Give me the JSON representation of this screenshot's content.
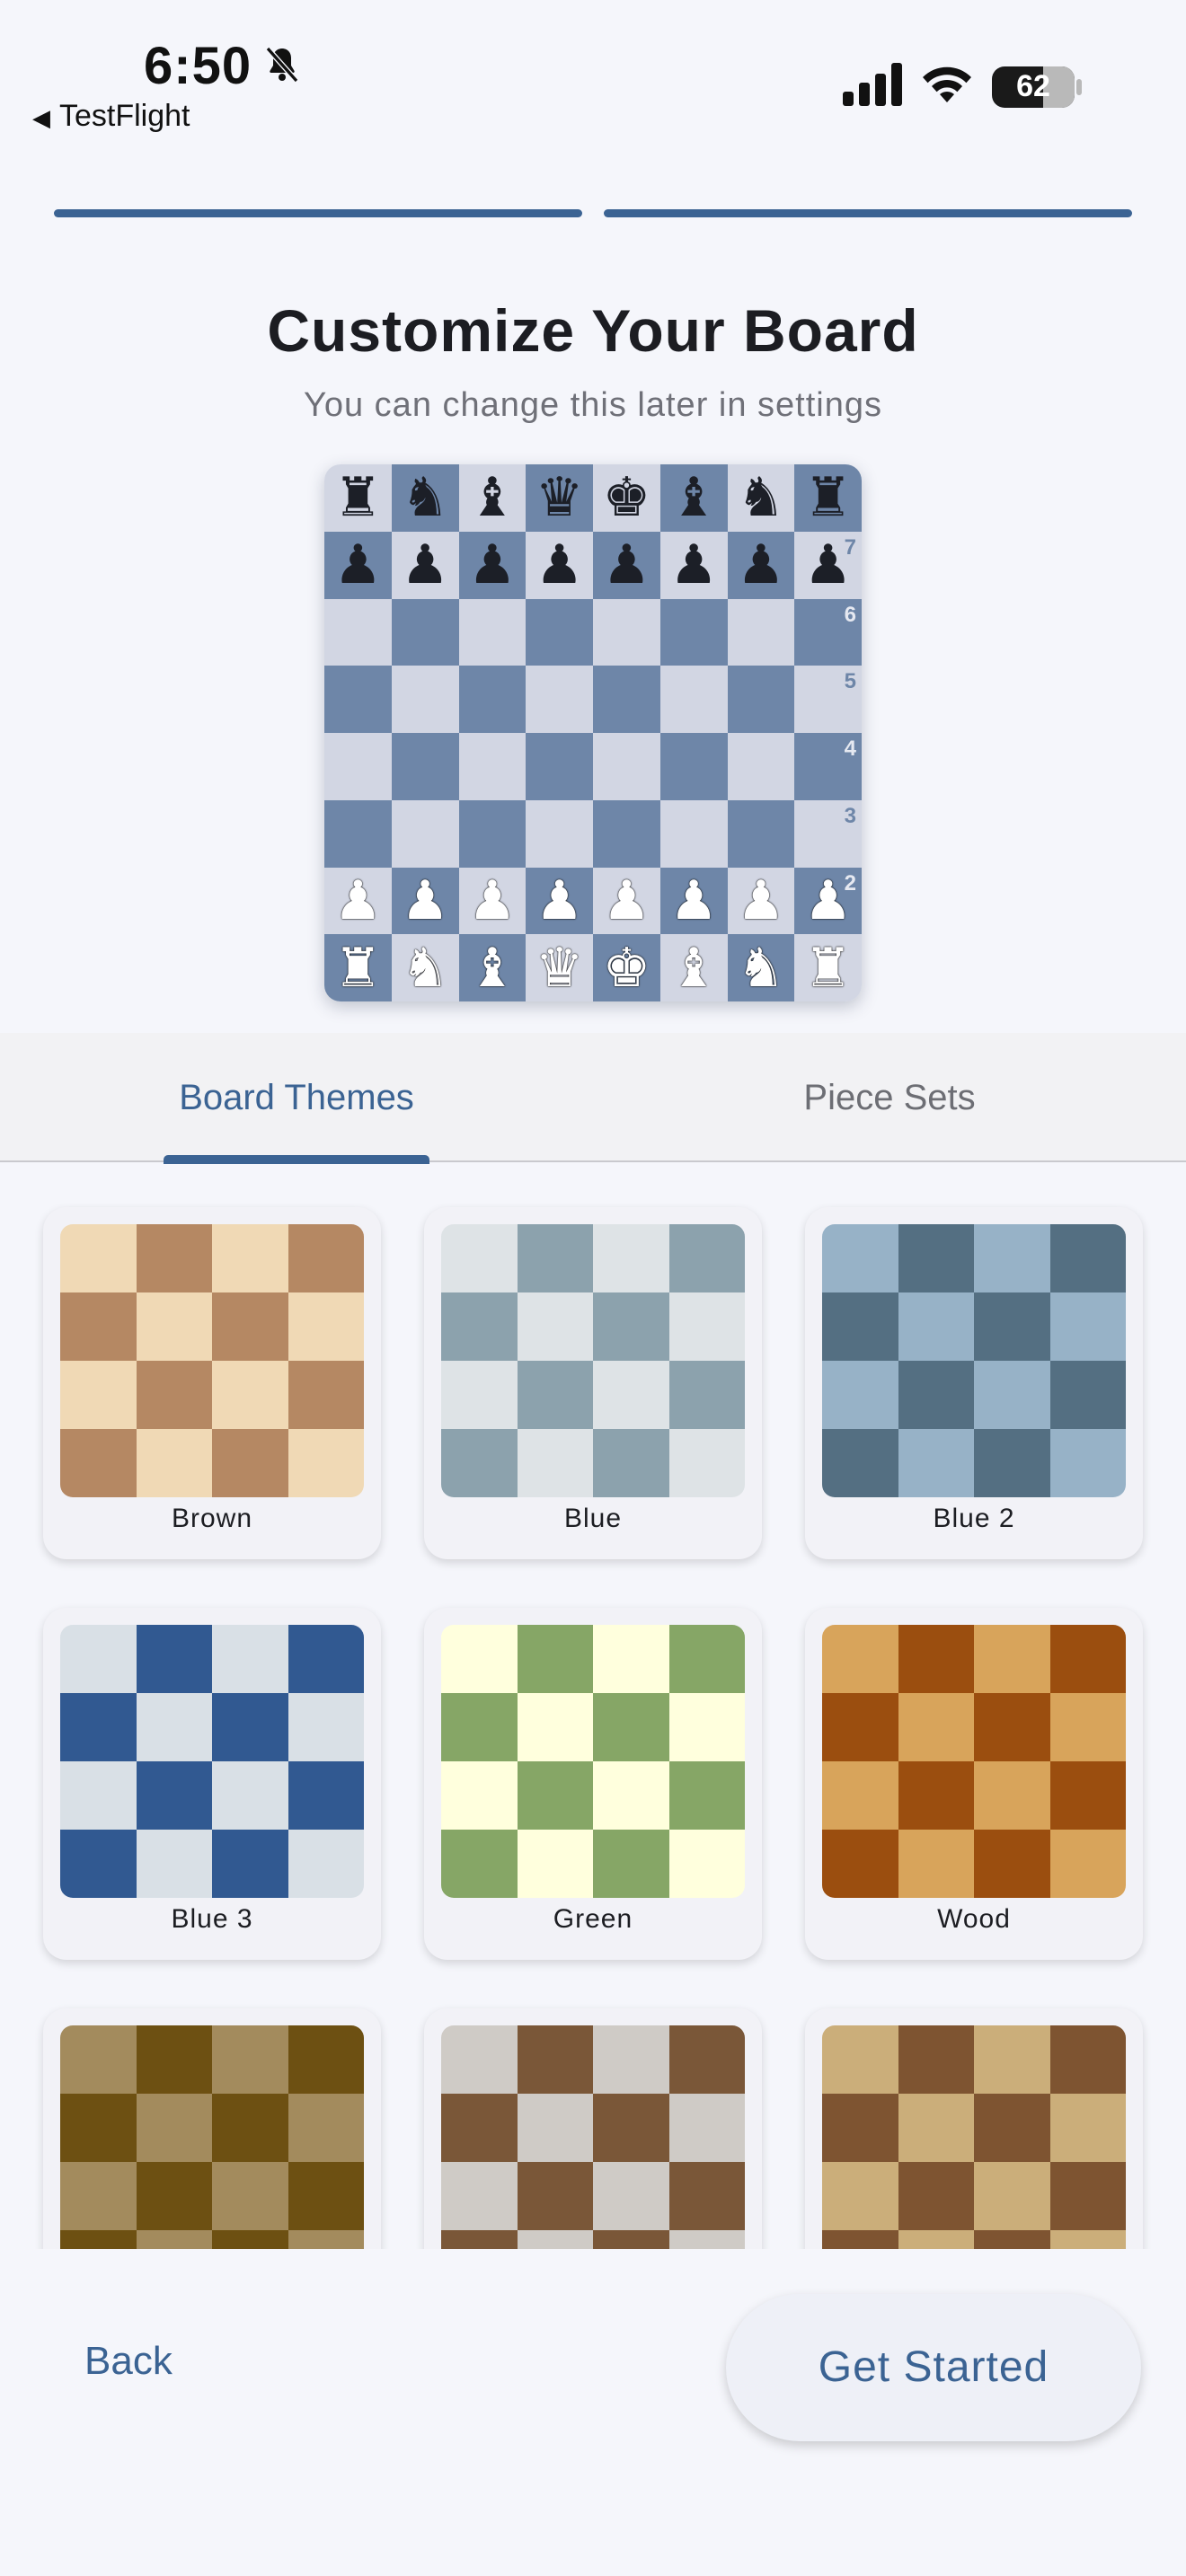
{
  "status_bar": {
    "time": "6:50",
    "back_app": "TestFlight",
    "battery": "62",
    "icons": [
      "bell-slash-icon",
      "signal-icon",
      "wifi-icon",
      "battery-icon"
    ]
  },
  "progress": {
    "steps": 2,
    "completed": 2
  },
  "header": {
    "title": "Customize Your Board",
    "subtitle": "You can change this later in settings"
  },
  "board_preview": {
    "light_color": "#d2d6e3",
    "dark_color": "#6e86a8",
    "rank_labels": [
      "7",
      "6",
      "5",
      "4",
      "3",
      "2"
    ],
    "rows": [
      [
        "br",
        "bn",
        "bb",
        "bq",
        "bk",
        "bb",
        "bn",
        "br"
      ],
      [
        "bp",
        "bp",
        "bp",
        "bp",
        "bp",
        "bp",
        "bp",
        "bp"
      ],
      [
        "",
        "",
        "",
        "",
        "",
        "",
        "",
        ""
      ],
      [
        "",
        "",
        "",
        "",
        "",
        "",
        "",
        ""
      ],
      [
        "",
        "",
        "",
        "",
        "",
        "",
        "",
        ""
      ],
      [
        "",
        "",
        "",
        "",
        "",
        "",
        "",
        ""
      ],
      [
        "wp",
        "wp",
        "wp",
        "wp",
        "wp",
        "wp",
        "wp",
        "wp"
      ],
      [
        "wr",
        "wn",
        "wb",
        "wq",
        "wk",
        "wb",
        "wn",
        "wr"
      ]
    ]
  },
  "tabs": [
    {
      "label": "Board Themes",
      "active": true
    },
    {
      "label": "Piece Sets",
      "active": false
    }
  ],
  "themes": [
    {
      "name": "Brown",
      "light": "#f0d9b5",
      "dark": "#b58863"
    },
    {
      "name": "Blue",
      "light": "#dee3e6",
      "dark": "#8ca2ad"
    },
    {
      "name": "Blue 2",
      "light": "#97b2c7",
      "dark": "#546f82"
    },
    {
      "name": "Blue 3",
      "light": "#d9e0e6",
      "dark": "#315991"
    },
    {
      "name": "Green",
      "light": "#ffffdd",
      "dark": "#86a666"
    },
    {
      "name": "Wood",
      "light": "#d8a45b",
      "dark": "#9b4e0f"
    },
    {
      "name": "",
      "light": "#a38b5d",
      "dark": "#6d5012"
    },
    {
      "name": "",
      "light": "#cfcbc6",
      "dark": "#7a5738"
    },
    {
      "name": "",
      "light": "#cbae7a",
      "dark": "#7e5431"
    }
  ],
  "footer": {
    "back_label": "Back",
    "start_label": "Get Started"
  },
  "accent_color": "#3b6393"
}
